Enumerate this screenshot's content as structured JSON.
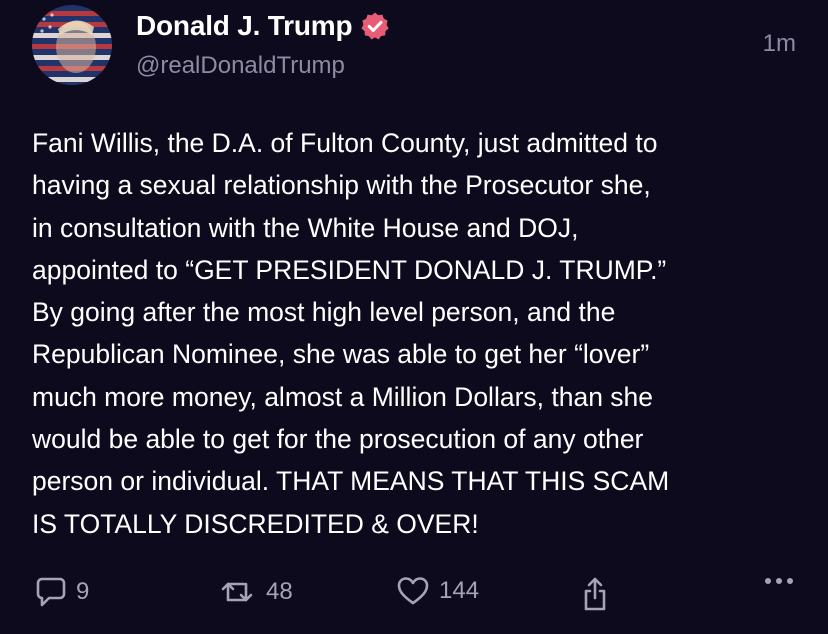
{
  "post": {
    "author": {
      "display_name": "Donald J. Trump",
      "handle": "@realDonaldTrump",
      "verified": true,
      "verified_color": "#e85d75"
    },
    "timestamp": "1m",
    "text": "Fani Willis, the D.A. of Fulton County, just admitted to\nhaving a sexual relationship with the Prosecutor she,\nin consultation with the White House and DOJ,\nappointed to “GET PRESIDENT DONALD J. TRUMP.”\nBy going after the most high level person, and the\nRepublican Nominee, she was able to get her “lover”\nmuch more money, almost a Million Dollars, than she\nwould be able to get for the prosecution of any other\nperson or individual. THAT MEANS THAT THIS SCAM\nIS TOTALLY DISCREDITED & OVER!"
  },
  "actions": {
    "reply": {
      "icon": "reply-icon",
      "count": "9"
    },
    "repost": {
      "icon": "repost-icon",
      "count": "48"
    },
    "like": {
      "icon": "heart-icon",
      "count": "144"
    },
    "share": {
      "icon": "share-icon"
    },
    "more": {
      "icon": "more-icon"
    }
  },
  "theme": {
    "background": "#0c0a1c",
    "text": "#ffffff",
    "muted": "#8e8aa3"
  }
}
